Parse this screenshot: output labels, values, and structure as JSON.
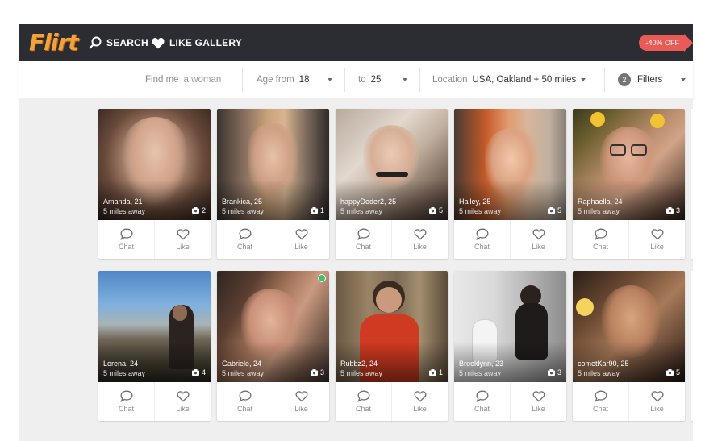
{
  "header": {
    "logo_text": "Flirt",
    "nav": {
      "search": "SEARCH",
      "like_gallery": "LIKE GALLERY"
    },
    "promo": "-40% OFF",
    "colors": {
      "bar": "#2b2d33",
      "logo": "#f2a33a",
      "promo": "#ea5b57"
    }
  },
  "filters": {
    "find_me_label": "Find me",
    "find_me_value": "a woman",
    "age_from_label": "Age from",
    "age_from_value": "18",
    "age_to_label": "to",
    "age_to_value": "25",
    "location_label": "Location",
    "location_value": "USA, Oakland + 50 miles",
    "filters_count": "2",
    "filters_label": "Filters"
  },
  "actions": {
    "chat": "Chat",
    "like": "Like"
  },
  "profiles": [
    {
      "name": "Amanda",
      "age": "21",
      "distance": "5 miles away",
      "photos": "2",
      "online": false
    },
    {
      "name": "Brankica",
      "age": "25",
      "distance": "5 miles away",
      "photos": "1",
      "online": false
    },
    {
      "name": "happyDoder2",
      "age": "25",
      "distance": "5 miles away",
      "photos": "5",
      "online": false
    },
    {
      "name": "Hailey",
      "age": "25",
      "distance": "5 miles away",
      "photos": "5",
      "online": false
    },
    {
      "name": "Raphaella",
      "age": "24",
      "distance": "5 miles away",
      "photos": "3",
      "online": false
    },
    {
      "name": "Lorena",
      "age": "24",
      "distance": "5 miles away",
      "photos": "4",
      "online": false
    },
    {
      "name": "Gabriele",
      "age": "24",
      "distance": "5 miles away",
      "photos": "3",
      "online": true
    },
    {
      "name": "Rubbz2",
      "age": "24",
      "distance": "5 miles away",
      "photos": "1",
      "online": false
    },
    {
      "name": "Brooklynn",
      "age": "23",
      "distance": "5 miles away",
      "photos": "3",
      "online": false
    },
    {
      "name": "cometKar90",
      "age": "25",
      "distance": "5 miles away",
      "photos": "5",
      "online": false
    }
  ]
}
